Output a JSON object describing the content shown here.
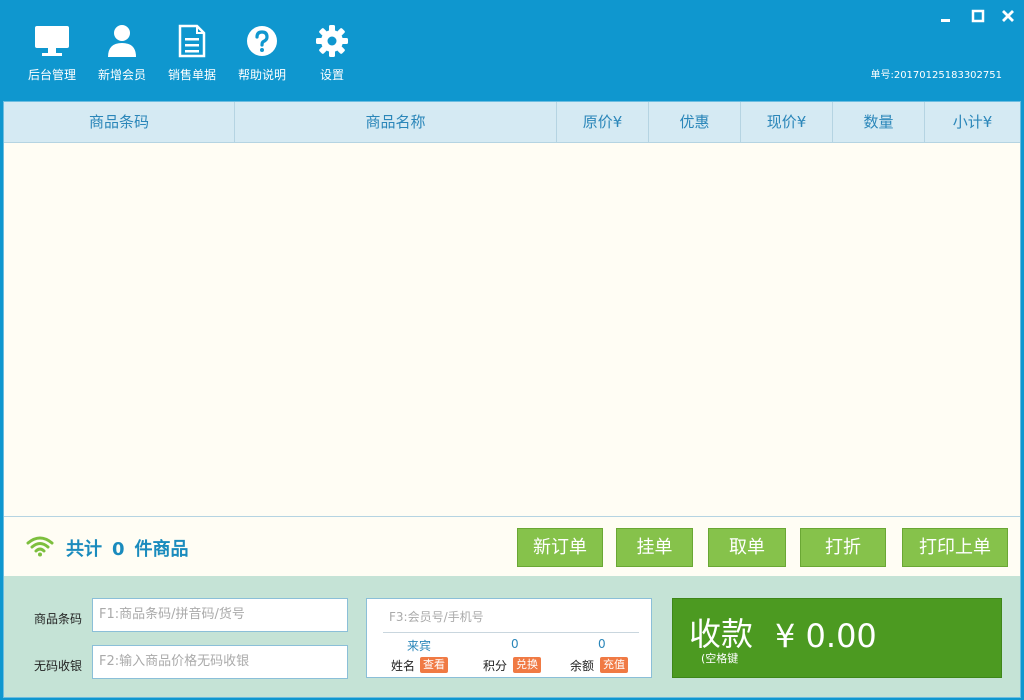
{
  "toolbar": {
    "items": [
      {
        "label": "后台管理",
        "icon": "monitor-icon"
      },
      {
        "label": "新增会员",
        "icon": "user-icon"
      },
      {
        "label": "销售单据",
        "icon": "document-icon"
      },
      {
        "label": "帮助说明",
        "icon": "help-icon"
      },
      {
        "label": "设置",
        "icon": "gear-icon"
      }
    ],
    "order_label": "单号:",
    "order_number": "20170125183302751"
  },
  "window_controls": [
    "minimize-icon",
    "maximize-icon",
    "close-icon"
  ],
  "table": {
    "columns": [
      "商品条码",
      "商品名称",
      "原价¥",
      "优惠",
      "现价¥",
      "数量",
      "小计¥"
    ],
    "rows": []
  },
  "summary": {
    "prefix": "共计",
    "count": "0",
    "suffix": "件商品"
  },
  "actions": [
    "新订单",
    "挂单",
    "取单",
    "打折",
    "打印上单"
  ],
  "inputs": {
    "barcode_label": "商品条码",
    "barcode_placeholder": "F1:商品条码/拼音码/货号",
    "nocode_label": "无码收银",
    "nocode_placeholder": "F2:输入商品价格无码收银"
  },
  "member": {
    "placeholder": "F3:会员号/手机号",
    "name_value": "来宾",
    "points_value": "0",
    "balance_value": "0",
    "name_label": "姓名",
    "view_tag": "查看",
    "points_label": "积分",
    "exchange_tag": "兑换",
    "balance_label": "余额",
    "recharge_tag": "充值"
  },
  "payment": {
    "label": "收款",
    "hint": "(空格键",
    "amount": "¥ 0.00"
  },
  "colors": {
    "header_blue": "#0f97cf",
    "action_green": "#86c24b",
    "pay_green": "#4c9a21",
    "tag_orange": "#f07a44",
    "panel_green": "#c5e3d6"
  }
}
